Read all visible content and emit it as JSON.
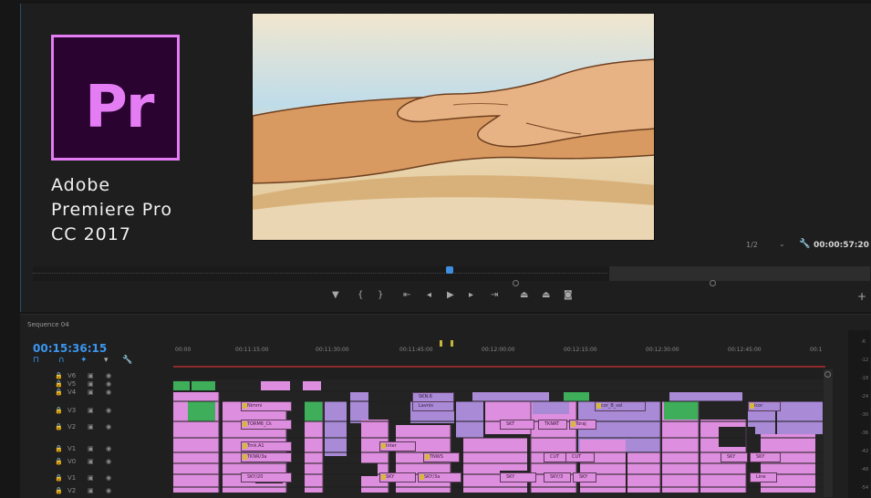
{
  "logo": {
    "glyph": "Pr",
    "bg": "#2a0331",
    "accent": "#e47cf4"
  },
  "caption": {
    "line1": "Adobe",
    "line2": "Premiere Pro",
    "line3": "CC 2017"
  },
  "program_monitor": {
    "zoom": "1/2",
    "zoom_dropdown_icon": "chevron-down-icon",
    "settings_icon": "wrench-icon",
    "timecode": "00:00:57:20",
    "transport": [
      "marker-icon",
      "in-point-icon",
      "out-point-icon",
      "go-to-in-icon",
      "step-back-icon",
      "play-icon",
      "step-forward-icon",
      "go-to-out-icon",
      "lift-icon",
      "extract-icon",
      "camera-icon"
    ],
    "add_button": "+"
  },
  "timeline": {
    "sequence_tab": "Sequence 04",
    "timecode": "00:15:36:15",
    "ruler": [
      "00:00",
      "00:11:15:00",
      "00:11:30:00",
      "00:11:45:00",
      "00:12:00:00",
      "00:12:15:00",
      "00:12:30:00",
      "00:12:45:00",
      "00:1"
    ],
    "tracks": [
      {
        "name": "V6"
      },
      {
        "name": "V5"
      },
      {
        "name": "V4"
      },
      {
        "name": "V3"
      },
      {
        "name": "V2"
      },
      {
        "name": "V1"
      },
      {
        "name": "V0"
      },
      {
        "name": "V1"
      },
      {
        "name": "V2"
      }
    ],
    "clip_labels": [
      "Nimmi",
      "SKN.6",
      "Lavnis",
      "TORM6_Ck",
      "TKNRT",
      "Toraj",
      "Trnk.A1",
      "TKNR/3a",
      "Inter",
      "TNWS",
      "SKY/20",
      "SKY",
      "SKY/3a",
      "CUT",
      "SKY/3",
      "SKY",
      "Line",
      "SKY",
      "SKT",
      "CUT",
      "cor_B_sol",
      "lcor",
      "SKY",
      "SKY"
    ],
    "colors": {
      "clip_pink": "#de8ede",
      "clip_purple": "#a88ad6",
      "clip_green": "#3fae5a",
      "clip_blue": "#7a9ad6"
    }
  },
  "meter": {
    "labels": [
      "-6",
      "-12",
      "-18",
      "-24",
      "-30",
      "-36",
      "-42",
      "-48",
      "-54"
    ]
  }
}
